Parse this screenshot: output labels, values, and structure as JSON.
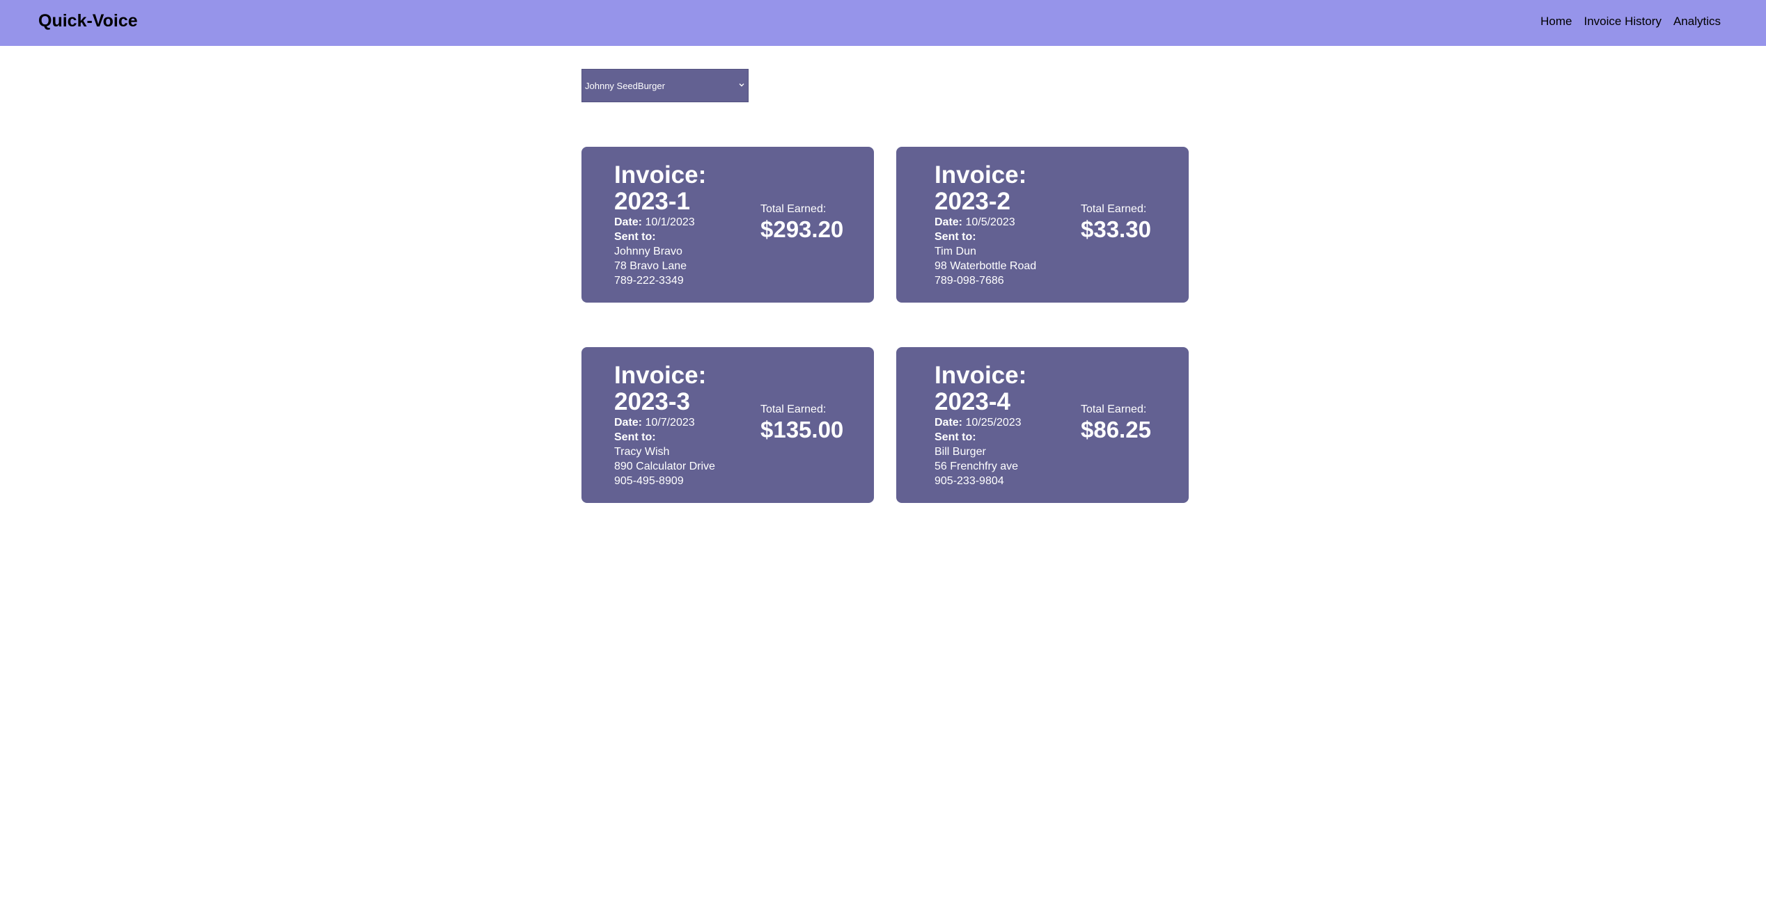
{
  "nav": {
    "brand": "Quick-Voice",
    "links": [
      "Home",
      "Invoice History",
      "Analytics"
    ]
  },
  "client_select": {
    "selected": "Johnny SeedBurger"
  },
  "labels": {
    "invoice_prefix": "Invoice:",
    "date": "Date:",
    "sent_to": "Sent to:",
    "total_earned": "Total Earned:"
  },
  "invoices": [
    {
      "number": "2023-1",
      "date": "10/1/2023",
      "name": "Johnny Bravo",
      "address": "78 Bravo Lane",
      "phone": "789-222-3349",
      "total": "$293.20"
    },
    {
      "number": "2023-2",
      "date": "10/5/2023",
      "name": "Tim Dun",
      "address": "98 Waterbottle Road",
      "phone": "789-098-7686",
      "total": "$33.30"
    },
    {
      "number": "2023-3",
      "date": "10/7/2023",
      "name": "Tracy Wish",
      "address": "890 Calculator Drive",
      "phone": "905-495-8909",
      "total": "$135.00"
    },
    {
      "number": "2023-4",
      "date": "10/25/2023",
      "name": "Bill Burger",
      "address": "56 Frenchfry ave",
      "phone": "905-233-9804",
      "total": "$86.25"
    }
  ],
  "colors": {
    "navbar": "#9694ea",
    "card": "#636192",
    "text_on_card": "#ffffff"
  }
}
